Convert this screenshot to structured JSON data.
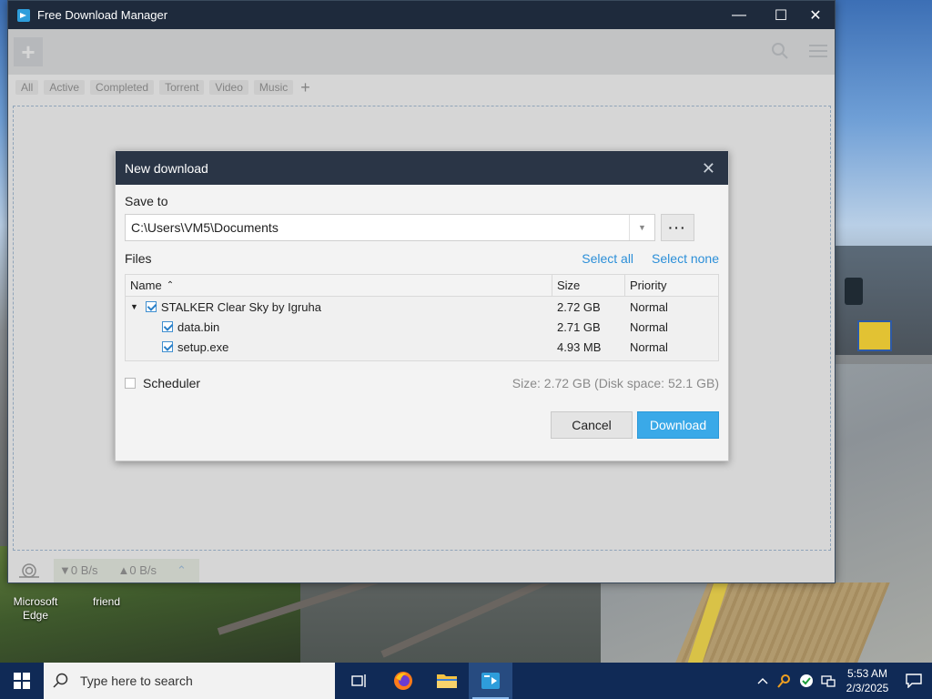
{
  "window": {
    "title": "Free Download Manager",
    "controls": {
      "minimize": "—",
      "maximize": "☐",
      "close": "✕"
    }
  },
  "toolbar": {
    "add_label": "+"
  },
  "filters": [
    "All",
    "Active",
    "Completed",
    "Torrent",
    "Video",
    "Music"
  ],
  "filter_add": "+",
  "statusbar": {
    "download_speed": "▼0 B/s",
    "upload_speed": "▲0 B/s",
    "expand": "⌃"
  },
  "dialog": {
    "title": "New download",
    "close": "✕",
    "save_to_label": "Save to",
    "save_path": "C:\\Users\\VM5\\Documents",
    "more_label": "···",
    "files_label": "Files",
    "select_all": "Select all",
    "select_none": "Select none",
    "columns": {
      "name": "Name",
      "sort_indicator": "⌃",
      "size": "Size",
      "priority": "Priority"
    },
    "files": [
      {
        "name": "STALKER Clear Sky by Igruha",
        "size": "2.72 GB",
        "priority": "Normal"
      },
      {
        "name": "data.bin",
        "size": "2.71 GB",
        "priority": "Normal"
      },
      {
        "name": "setup.exe",
        "size": "4.93 MB",
        "priority": "Normal"
      }
    ],
    "scheduler_label": "Scheduler",
    "size_info": "Size: 2.72 GB (Disk space: 52.1 GB)",
    "cancel_label": "Cancel",
    "download_label": "Download"
  },
  "desktop_icons": [
    {
      "label": "Microsoft\nEdge"
    },
    {
      "label": "friend"
    }
  ],
  "taskbar": {
    "search_placeholder": "Type here to search",
    "time": "5:53 AM",
    "date": "2/3/2025"
  },
  "colors": {
    "accent": "#3aa9e8",
    "titlebar": "#1e2a3c",
    "dialog_header": "#2a3546",
    "link": "#2c8fd8",
    "taskbar": "#102a56"
  }
}
